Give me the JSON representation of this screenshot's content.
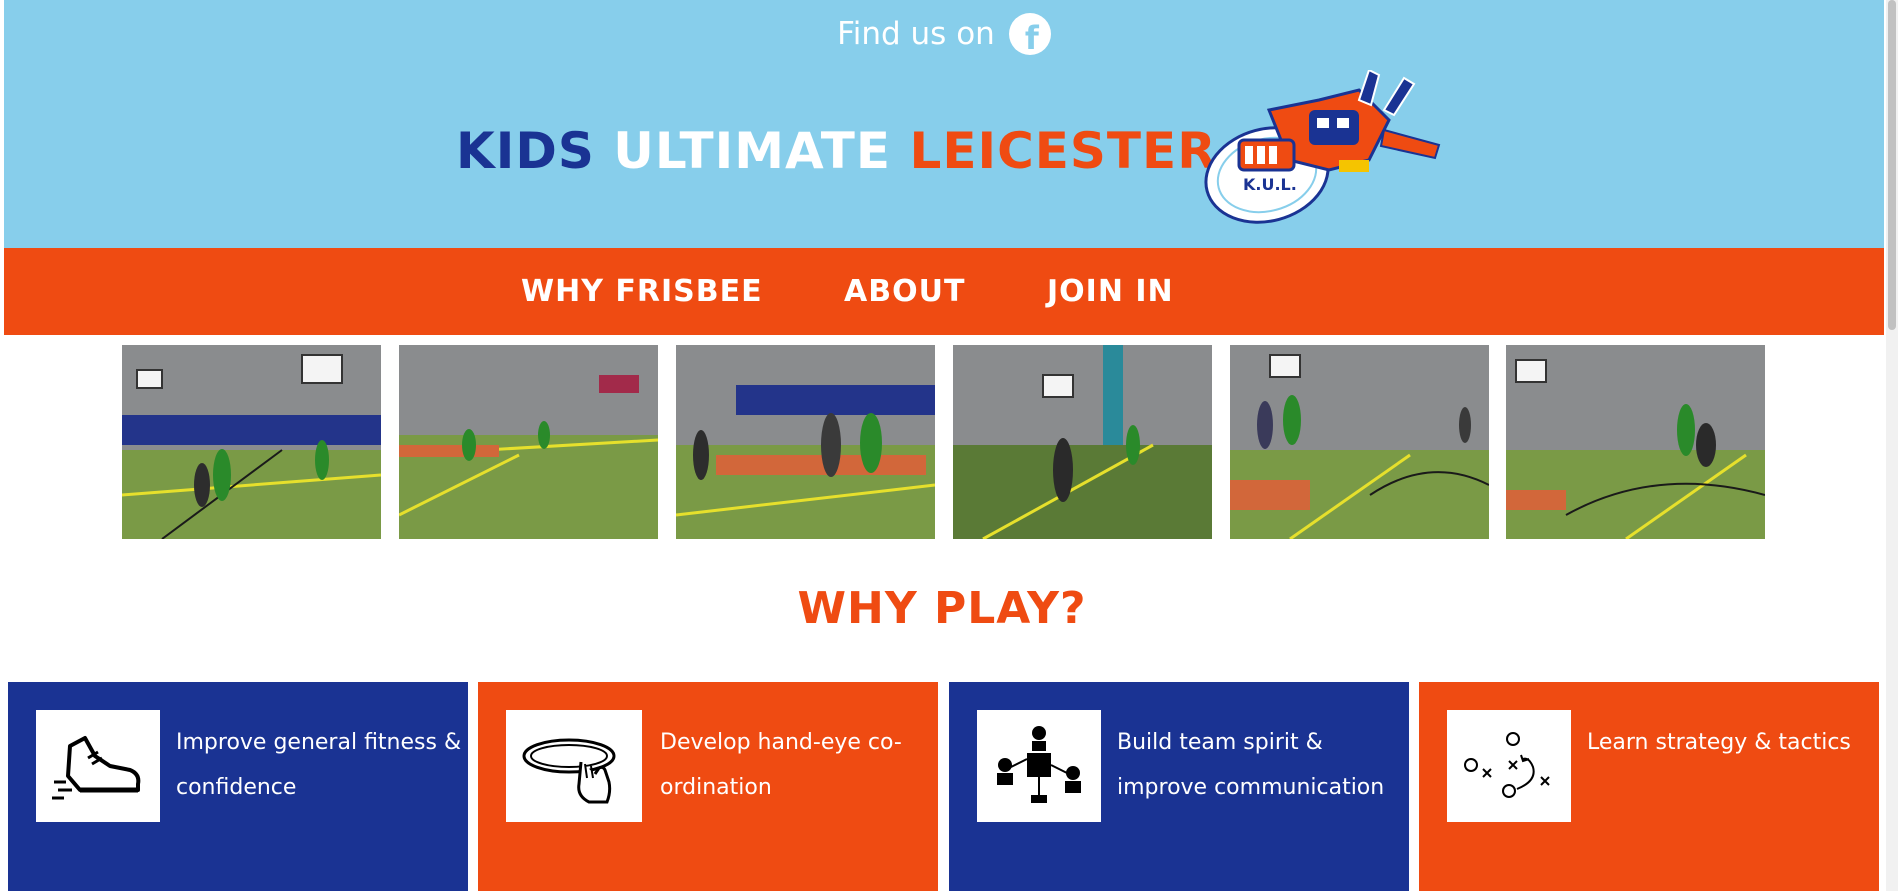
{
  "header": {
    "find_us": "Find us on",
    "facebook_icon": "facebook-icon",
    "title": {
      "word1": "KIDS",
      "word2": "ULTIMATE",
      "word3": "LEICESTER"
    },
    "logo": "robot-frisbee-logo",
    "logo_text": "K.U.L."
  },
  "nav": {
    "items": [
      {
        "label": "WHY FRISBEE"
      },
      {
        "label": "ABOUT"
      },
      {
        "label": "JOIN IN"
      }
    ]
  },
  "gallery": {
    "image_count": 6
  },
  "why_play": {
    "title": "WHY PLAY?",
    "cards": [
      {
        "text": "Improve general fitness & confidence",
        "icon": "running-shoe-icon",
        "color": "#1a3393"
      },
      {
        "text": "Develop hand-eye co-ordination",
        "icon": "hand-catching-frisbee-icon",
        "color": "#ef4b12"
      },
      {
        "text": "Build team spirit & improve communication",
        "icon": "team-people-icon",
        "color": "#1a3393"
      },
      {
        "text": "Learn strategy & tactics",
        "icon": "strategy-play-icon",
        "color": "#ef4b12"
      }
    ]
  },
  "colors": {
    "sky": "#87ceeb",
    "brand_orange": "#ef4b12",
    "brand_blue": "#1a3393"
  }
}
